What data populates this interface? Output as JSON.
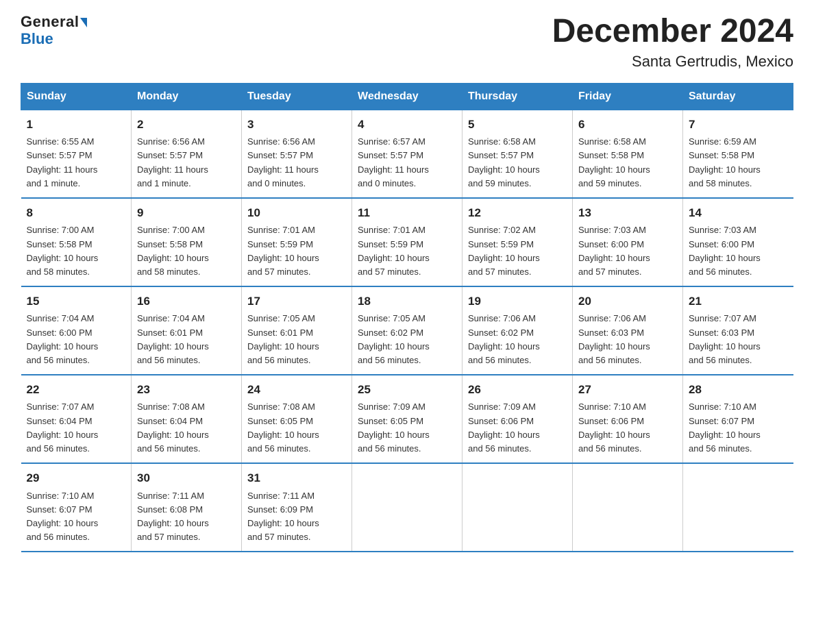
{
  "header": {
    "logo_line1": "General",
    "logo_line2": "Blue",
    "title": "December 2024",
    "subtitle": "Santa Gertrudis, Mexico"
  },
  "columns": [
    "Sunday",
    "Monday",
    "Tuesday",
    "Wednesday",
    "Thursday",
    "Friday",
    "Saturday"
  ],
  "weeks": [
    [
      {
        "day": "1",
        "info": "Sunrise: 6:55 AM\nSunset: 5:57 PM\nDaylight: 11 hours\nand 1 minute."
      },
      {
        "day": "2",
        "info": "Sunrise: 6:56 AM\nSunset: 5:57 PM\nDaylight: 11 hours\nand 1 minute."
      },
      {
        "day": "3",
        "info": "Sunrise: 6:56 AM\nSunset: 5:57 PM\nDaylight: 11 hours\nand 0 minutes."
      },
      {
        "day": "4",
        "info": "Sunrise: 6:57 AM\nSunset: 5:57 PM\nDaylight: 11 hours\nand 0 minutes."
      },
      {
        "day": "5",
        "info": "Sunrise: 6:58 AM\nSunset: 5:57 PM\nDaylight: 10 hours\nand 59 minutes."
      },
      {
        "day": "6",
        "info": "Sunrise: 6:58 AM\nSunset: 5:58 PM\nDaylight: 10 hours\nand 59 minutes."
      },
      {
        "day": "7",
        "info": "Sunrise: 6:59 AM\nSunset: 5:58 PM\nDaylight: 10 hours\nand 58 minutes."
      }
    ],
    [
      {
        "day": "8",
        "info": "Sunrise: 7:00 AM\nSunset: 5:58 PM\nDaylight: 10 hours\nand 58 minutes."
      },
      {
        "day": "9",
        "info": "Sunrise: 7:00 AM\nSunset: 5:58 PM\nDaylight: 10 hours\nand 58 minutes."
      },
      {
        "day": "10",
        "info": "Sunrise: 7:01 AM\nSunset: 5:59 PM\nDaylight: 10 hours\nand 57 minutes."
      },
      {
        "day": "11",
        "info": "Sunrise: 7:01 AM\nSunset: 5:59 PM\nDaylight: 10 hours\nand 57 minutes."
      },
      {
        "day": "12",
        "info": "Sunrise: 7:02 AM\nSunset: 5:59 PM\nDaylight: 10 hours\nand 57 minutes."
      },
      {
        "day": "13",
        "info": "Sunrise: 7:03 AM\nSunset: 6:00 PM\nDaylight: 10 hours\nand 57 minutes."
      },
      {
        "day": "14",
        "info": "Sunrise: 7:03 AM\nSunset: 6:00 PM\nDaylight: 10 hours\nand 56 minutes."
      }
    ],
    [
      {
        "day": "15",
        "info": "Sunrise: 7:04 AM\nSunset: 6:00 PM\nDaylight: 10 hours\nand 56 minutes."
      },
      {
        "day": "16",
        "info": "Sunrise: 7:04 AM\nSunset: 6:01 PM\nDaylight: 10 hours\nand 56 minutes."
      },
      {
        "day": "17",
        "info": "Sunrise: 7:05 AM\nSunset: 6:01 PM\nDaylight: 10 hours\nand 56 minutes."
      },
      {
        "day": "18",
        "info": "Sunrise: 7:05 AM\nSunset: 6:02 PM\nDaylight: 10 hours\nand 56 minutes."
      },
      {
        "day": "19",
        "info": "Sunrise: 7:06 AM\nSunset: 6:02 PM\nDaylight: 10 hours\nand 56 minutes."
      },
      {
        "day": "20",
        "info": "Sunrise: 7:06 AM\nSunset: 6:03 PM\nDaylight: 10 hours\nand 56 minutes."
      },
      {
        "day": "21",
        "info": "Sunrise: 7:07 AM\nSunset: 6:03 PM\nDaylight: 10 hours\nand 56 minutes."
      }
    ],
    [
      {
        "day": "22",
        "info": "Sunrise: 7:07 AM\nSunset: 6:04 PM\nDaylight: 10 hours\nand 56 minutes."
      },
      {
        "day": "23",
        "info": "Sunrise: 7:08 AM\nSunset: 6:04 PM\nDaylight: 10 hours\nand 56 minutes."
      },
      {
        "day": "24",
        "info": "Sunrise: 7:08 AM\nSunset: 6:05 PM\nDaylight: 10 hours\nand 56 minutes."
      },
      {
        "day": "25",
        "info": "Sunrise: 7:09 AM\nSunset: 6:05 PM\nDaylight: 10 hours\nand 56 minutes."
      },
      {
        "day": "26",
        "info": "Sunrise: 7:09 AM\nSunset: 6:06 PM\nDaylight: 10 hours\nand 56 minutes."
      },
      {
        "day": "27",
        "info": "Sunrise: 7:10 AM\nSunset: 6:06 PM\nDaylight: 10 hours\nand 56 minutes."
      },
      {
        "day": "28",
        "info": "Sunrise: 7:10 AM\nSunset: 6:07 PM\nDaylight: 10 hours\nand 56 minutes."
      }
    ],
    [
      {
        "day": "29",
        "info": "Sunrise: 7:10 AM\nSunset: 6:07 PM\nDaylight: 10 hours\nand 56 minutes."
      },
      {
        "day": "30",
        "info": "Sunrise: 7:11 AM\nSunset: 6:08 PM\nDaylight: 10 hours\nand 57 minutes."
      },
      {
        "day": "31",
        "info": "Sunrise: 7:11 AM\nSunset: 6:09 PM\nDaylight: 10 hours\nand 57 minutes."
      },
      {
        "day": "",
        "info": ""
      },
      {
        "day": "",
        "info": ""
      },
      {
        "day": "",
        "info": ""
      },
      {
        "day": "",
        "info": ""
      }
    ]
  ]
}
